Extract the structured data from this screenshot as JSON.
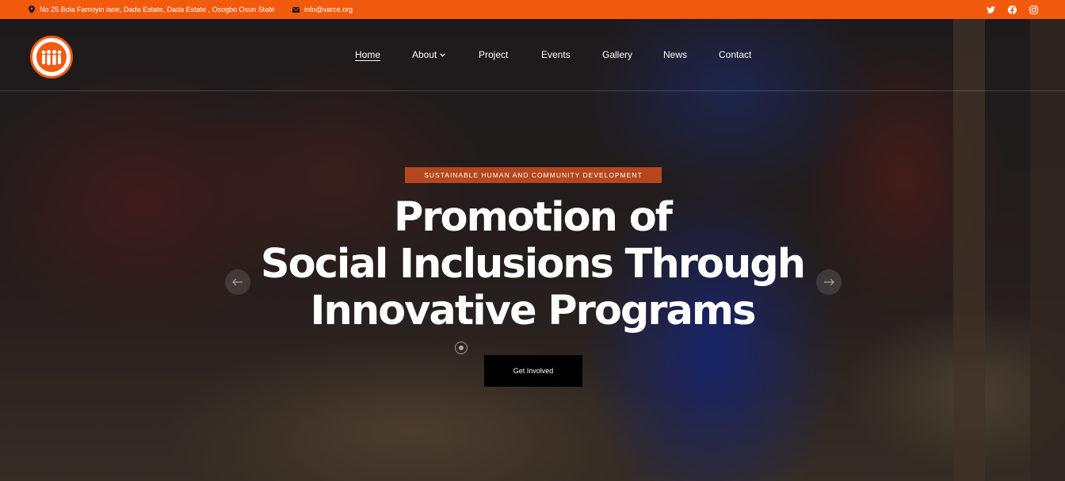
{
  "topbar": {
    "address": "No 25 Bola Famoyin lane, Dada Estate, Dada Estate , Osogbo Osun State",
    "email": "info@varce.org",
    "background": "#f25a0e",
    "social_icons": [
      "twitter-icon",
      "facebook-icon",
      "instagram-icon"
    ]
  },
  "nav": {
    "items": [
      "Home",
      "About",
      "Project",
      "Events",
      "Gallery",
      "News",
      "Contact"
    ],
    "active": "Home"
  },
  "hero": {
    "tag": "SUSTAINABLE HUMAN AND COMMUNITY DEVELOPMENT",
    "tag_color": "#b5461d",
    "headline_lines": [
      "Promotion of",
      "Social Inclusions Through",
      "Innovative Programs"
    ],
    "cta_label": "Get Involved",
    "cta_color": "#000000",
    "prev_icon": "arrow-left-icon",
    "next_icon": "arrow-right-icon"
  }
}
